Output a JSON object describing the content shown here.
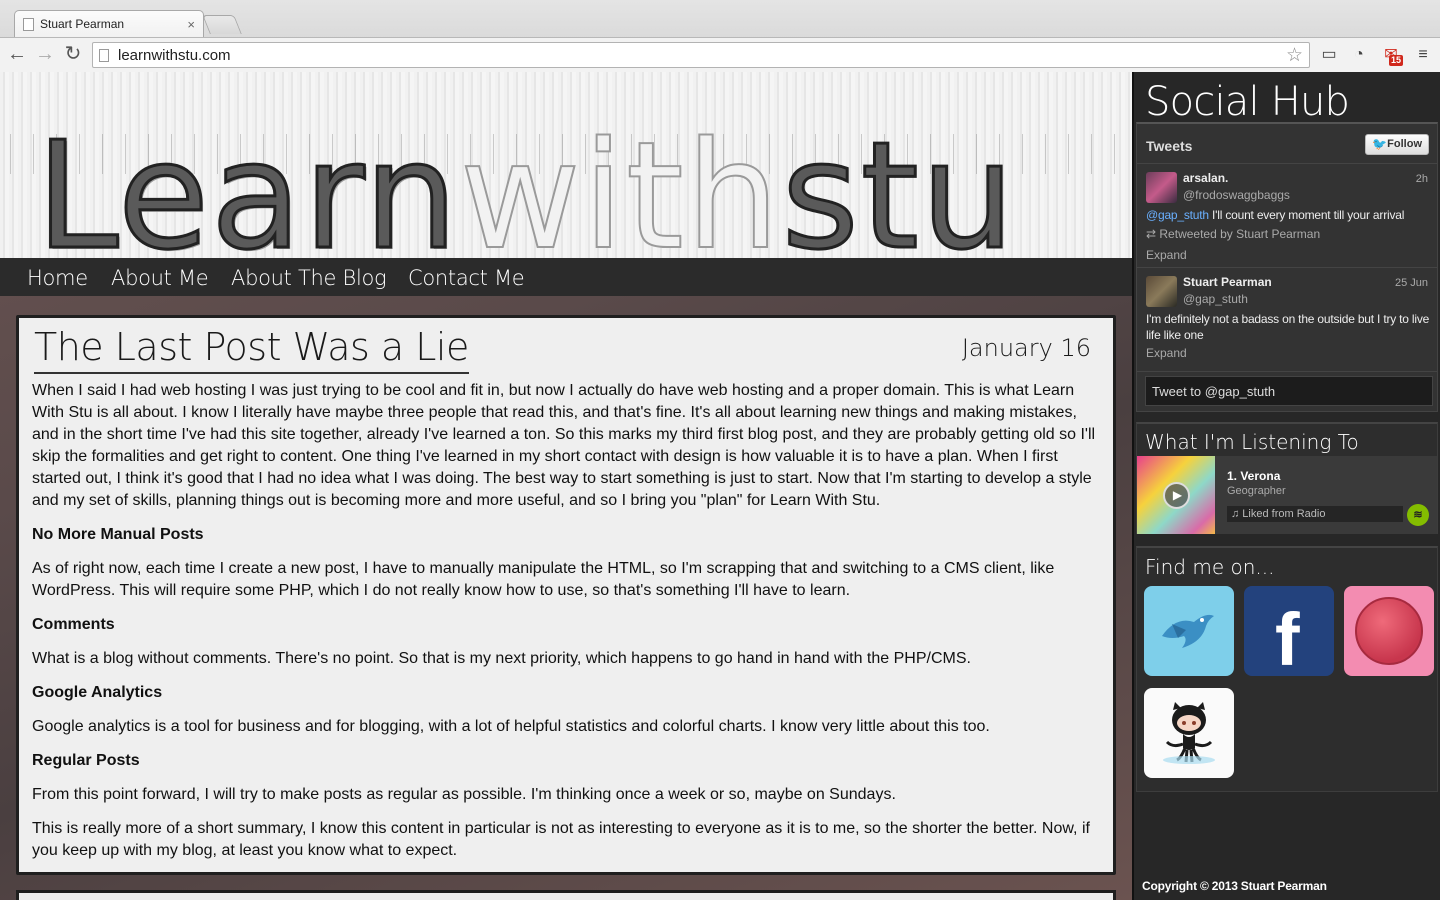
{
  "browser": {
    "tab_title": "Stuart Pearman",
    "tab_close": "×",
    "url": "learnwithstu.com",
    "gmail_count": "15"
  },
  "header": {
    "logo_part1": "Learn",
    "logo_part2": "with",
    "logo_part3": "stu"
  },
  "nav": {
    "items": [
      "Home",
      "About Me",
      "About The Blog",
      "Contact Me"
    ]
  },
  "post": {
    "title": "The Last Post Was a Lie",
    "date": "January 16",
    "intro": "When I said I had web hosting I was just trying to be cool and fit in, but now I actually do have web hosting and a proper domain. This is what Learn With Stu is all about. I know I literally have maybe three people that read this, and that's fine. It's all about learning new things and making mistakes, and in the short time I've had this site together, already I've learned a ton. So this marks my third first blog post, and they are probably getting old so I'll skip the formalities and get right to content. One thing I've learned in my short contact with design is how valuable it is to have a plan. When I first started out, I think it's good that I had no idea what I was doing. The best way to start something is just to start. Now that I'm starting to develop a style and my set of skills, planning things out is becoming more and more useful, and so I bring you \"plan\" for Learn With Stu.",
    "sections": [
      {
        "heading": "No More Manual Posts",
        "text": "As of right now, each time I create a new post, I have to manually manipulate the HTML, so I'm scrapping that and switching to a CMS client, like WordPress. This will require some PHP, which I do not really know how to use, so that's something I'll have to learn."
      },
      {
        "heading": "Comments",
        "text": "What is a blog without comments. There's no point. So that is my next priority, which happens to go hand in hand with the PHP/CMS."
      },
      {
        "heading": "Google Analytics",
        "text": "Google analytics is a tool for business and for blogging, with a lot of helpful statistics and colorful charts. I know very little about this too."
      },
      {
        "heading": "Regular Posts",
        "text": "From this point forward, I will try to make posts as regular as possible. I'm thinking once a week or so, maybe on Sundays."
      }
    ],
    "outro": "This is really more of a short summary, I know this content in particular is not as interesting to everyone as it is to me, so the shorter the better. Now, if you keep up with my blog, at least you know what to expect."
  },
  "sidebar": {
    "hub_title": "Social Hub",
    "tweets_label": "Tweets",
    "follow_label": "Follow",
    "tweets": [
      {
        "name": "arsalan.",
        "handle": "@frodoswaggbaggs",
        "time": "2h",
        "mention": "@gap_stuth",
        "text": " I'll count every moment till your arrival",
        "retweet": "Retweeted by Stuart Pearman",
        "expand": "Expand"
      },
      {
        "name": "Stuart Pearman",
        "handle": "@gap_stuth",
        "time": "25 Jun",
        "text": "I'm definitely not a badass on the outside but I try to live life like one",
        "expand": "Expand"
      }
    ],
    "tweet_to": "Tweet to @gap_stuth",
    "listening_title": "What I'm Listening To",
    "song": "1. Verona",
    "artist": "Geographer",
    "liked_from": "♫ Liked from Radio",
    "find_title": "Find me on...",
    "copyright": "Copyright © 2013 Stuart Pearman"
  }
}
